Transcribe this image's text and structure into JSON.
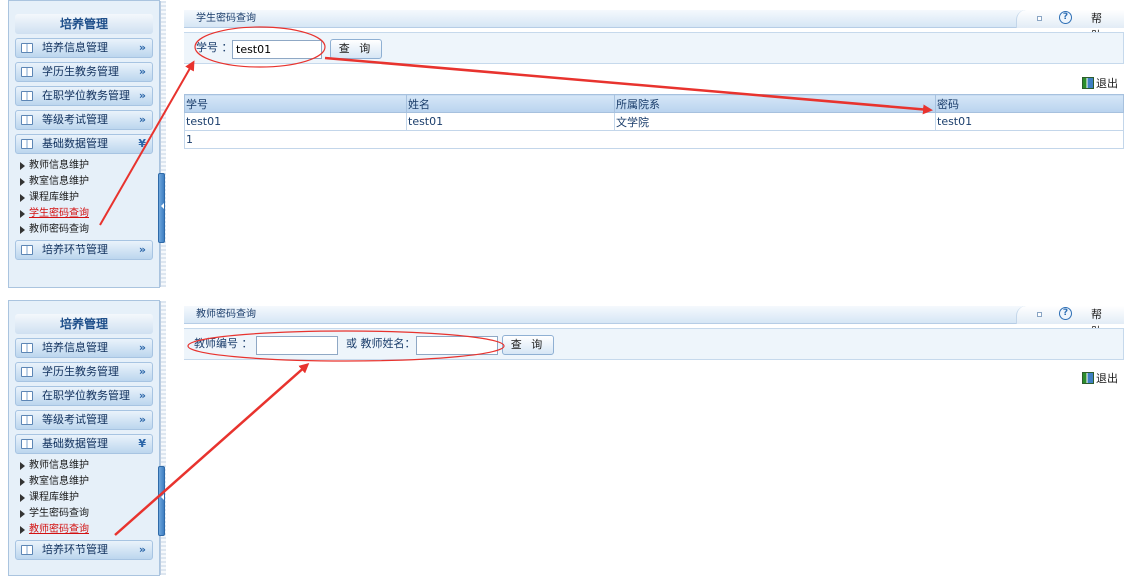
{
  "sidebar": {
    "title": "培养管理",
    "items": [
      {
        "label": "培养信息管理",
        "chev": "»"
      },
      {
        "label": "学历生教务管理",
        "chev": "»"
      },
      {
        "label": "在职学位教务管理",
        "chev": "»"
      },
      {
        "label": "等级考试管理",
        "chev": "»"
      },
      {
        "label": "基础数据管理",
        "chev": "¥"
      }
    ],
    "sub_items": [
      "教师信息维护",
      "教室信息维护",
      "课程库维护",
      "学生密码查询",
      "教师密码查询"
    ],
    "last_item": {
      "label": "培养环节管理",
      "chev": "»"
    }
  },
  "student_panel": {
    "title": "学生密码查询",
    "help_label": "帮助",
    "search_label": "学号 ：",
    "search_value": "test01",
    "search_button": "查 询",
    "exit_label": "退出",
    "table": {
      "headers": [
        "学号",
        "姓名",
        "所属院系",
        "密码"
      ],
      "rows": [
        [
          "test01",
          "test01",
          "文学院",
          "test01"
        ]
      ],
      "footer": "1"
    },
    "active_sub_item_index": 3
  },
  "teacher_panel": {
    "title": "教师密码查询",
    "help_label": "帮助",
    "id_label": "教师编号 ：",
    "id_value": "",
    "or_label": "或 教师姓名：",
    "name_value": "",
    "search_button": "查 询",
    "exit_label": "退出",
    "active_sub_item_index": 4
  },
  "colors": {
    "annotation": "#e8332e",
    "accent": "#2e6fb5"
  }
}
